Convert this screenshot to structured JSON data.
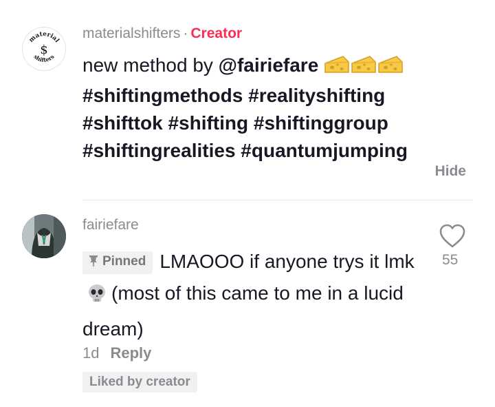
{
  "creator_comment": {
    "username": "materialshifters",
    "separator": "·",
    "badge": "Creator",
    "avatar_text_top": "material",
    "avatar_text_bottom": "shifters",
    "avatar_symbol": "$",
    "caption_prefix": "new method by ",
    "mention": "@fairiefare",
    "emoji": "cheese-wedge",
    "hashtags": "#shiftingmethods #realityshifting #shifttok #shifting #shiftinggroup #shiftingrealities #quantumjumping",
    "hide_label": "Hide"
  },
  "reply": {
    "username": "fairiefare",
    "pinned_label": "Pinned",
    "text_part1": "LMAOOO if anyone trys it lmk",
    "emoji": "skull",
    "text_part2": "(most of this came to me in a lucid dream)",
    "age": "1d",
    "reply_label": "Reply",
    "liked_by": "Liked by creator",
    "like_count": "55"
  },
  "colors": {
    "creator_badge": "#fe2c55",
    "muted_text": "#8a8b91",
    "primary_text": "#161823",
    "tag_background": "#f1f1f2"
  },
  "icons": [
    "pin-icon",
    "heart-icon",
    "cheese-emoji",
    "skull-emoji"
  ]
}
